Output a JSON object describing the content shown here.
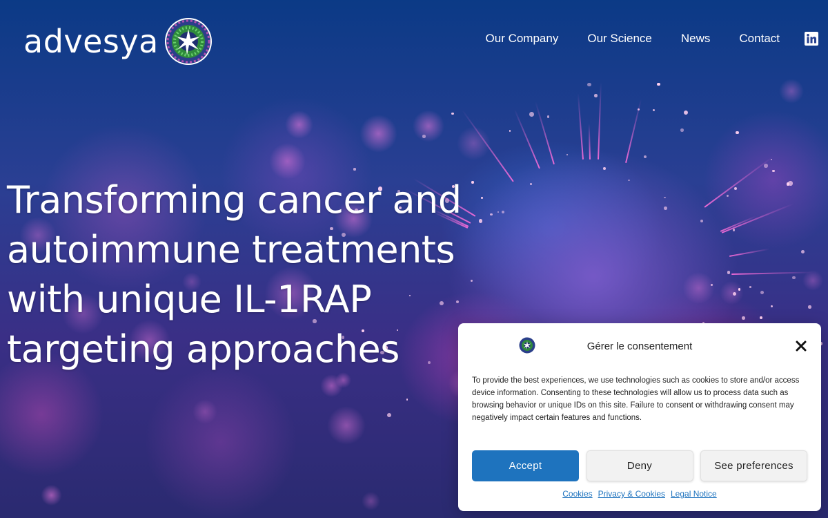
{
  "brand": {
    "name": "advesya"
  },
  "nav": {
    "items": [
      {
        "label": "Our Company"
      },
      {
        "label": "Our Science"
      },
      {
        "label": "News"
      },
      {
        "label": "Contact"
      }
    ],
    "social_icon": "linkedin-icon"
  },
  "hero": {
    "title": "Transforming cancer and autoimmune treatments with unique IL-1RAP targeting approaches"
  },
  "consent": {
    "title": "Gérer le consentement",
    "text": "To provide the best experiences, we use technologies such as cookies to store and/or access device information. Consenting to these technologies will allow us to process data such as browsing behavior or unique IDs on this site. Failure to consent or withdrawing consent may negatively impact certain features and functions.",
    "buttons": {
      "accept": "Accept",
      "deny": "Deny",
      "preferences": "See preferences"
    },
    "links": {
      "cookies": "Cookies",
      "privacy": "Privacy & Cookies",
      "legal": "Legal Notice"
    },
    "close_icon": "close-icon"
  },
  "colors": {
    "accent": "#1e73be",
    "background_top": "#0b3a86",
    "cell_magenta": "#e040b0"
  }
}
